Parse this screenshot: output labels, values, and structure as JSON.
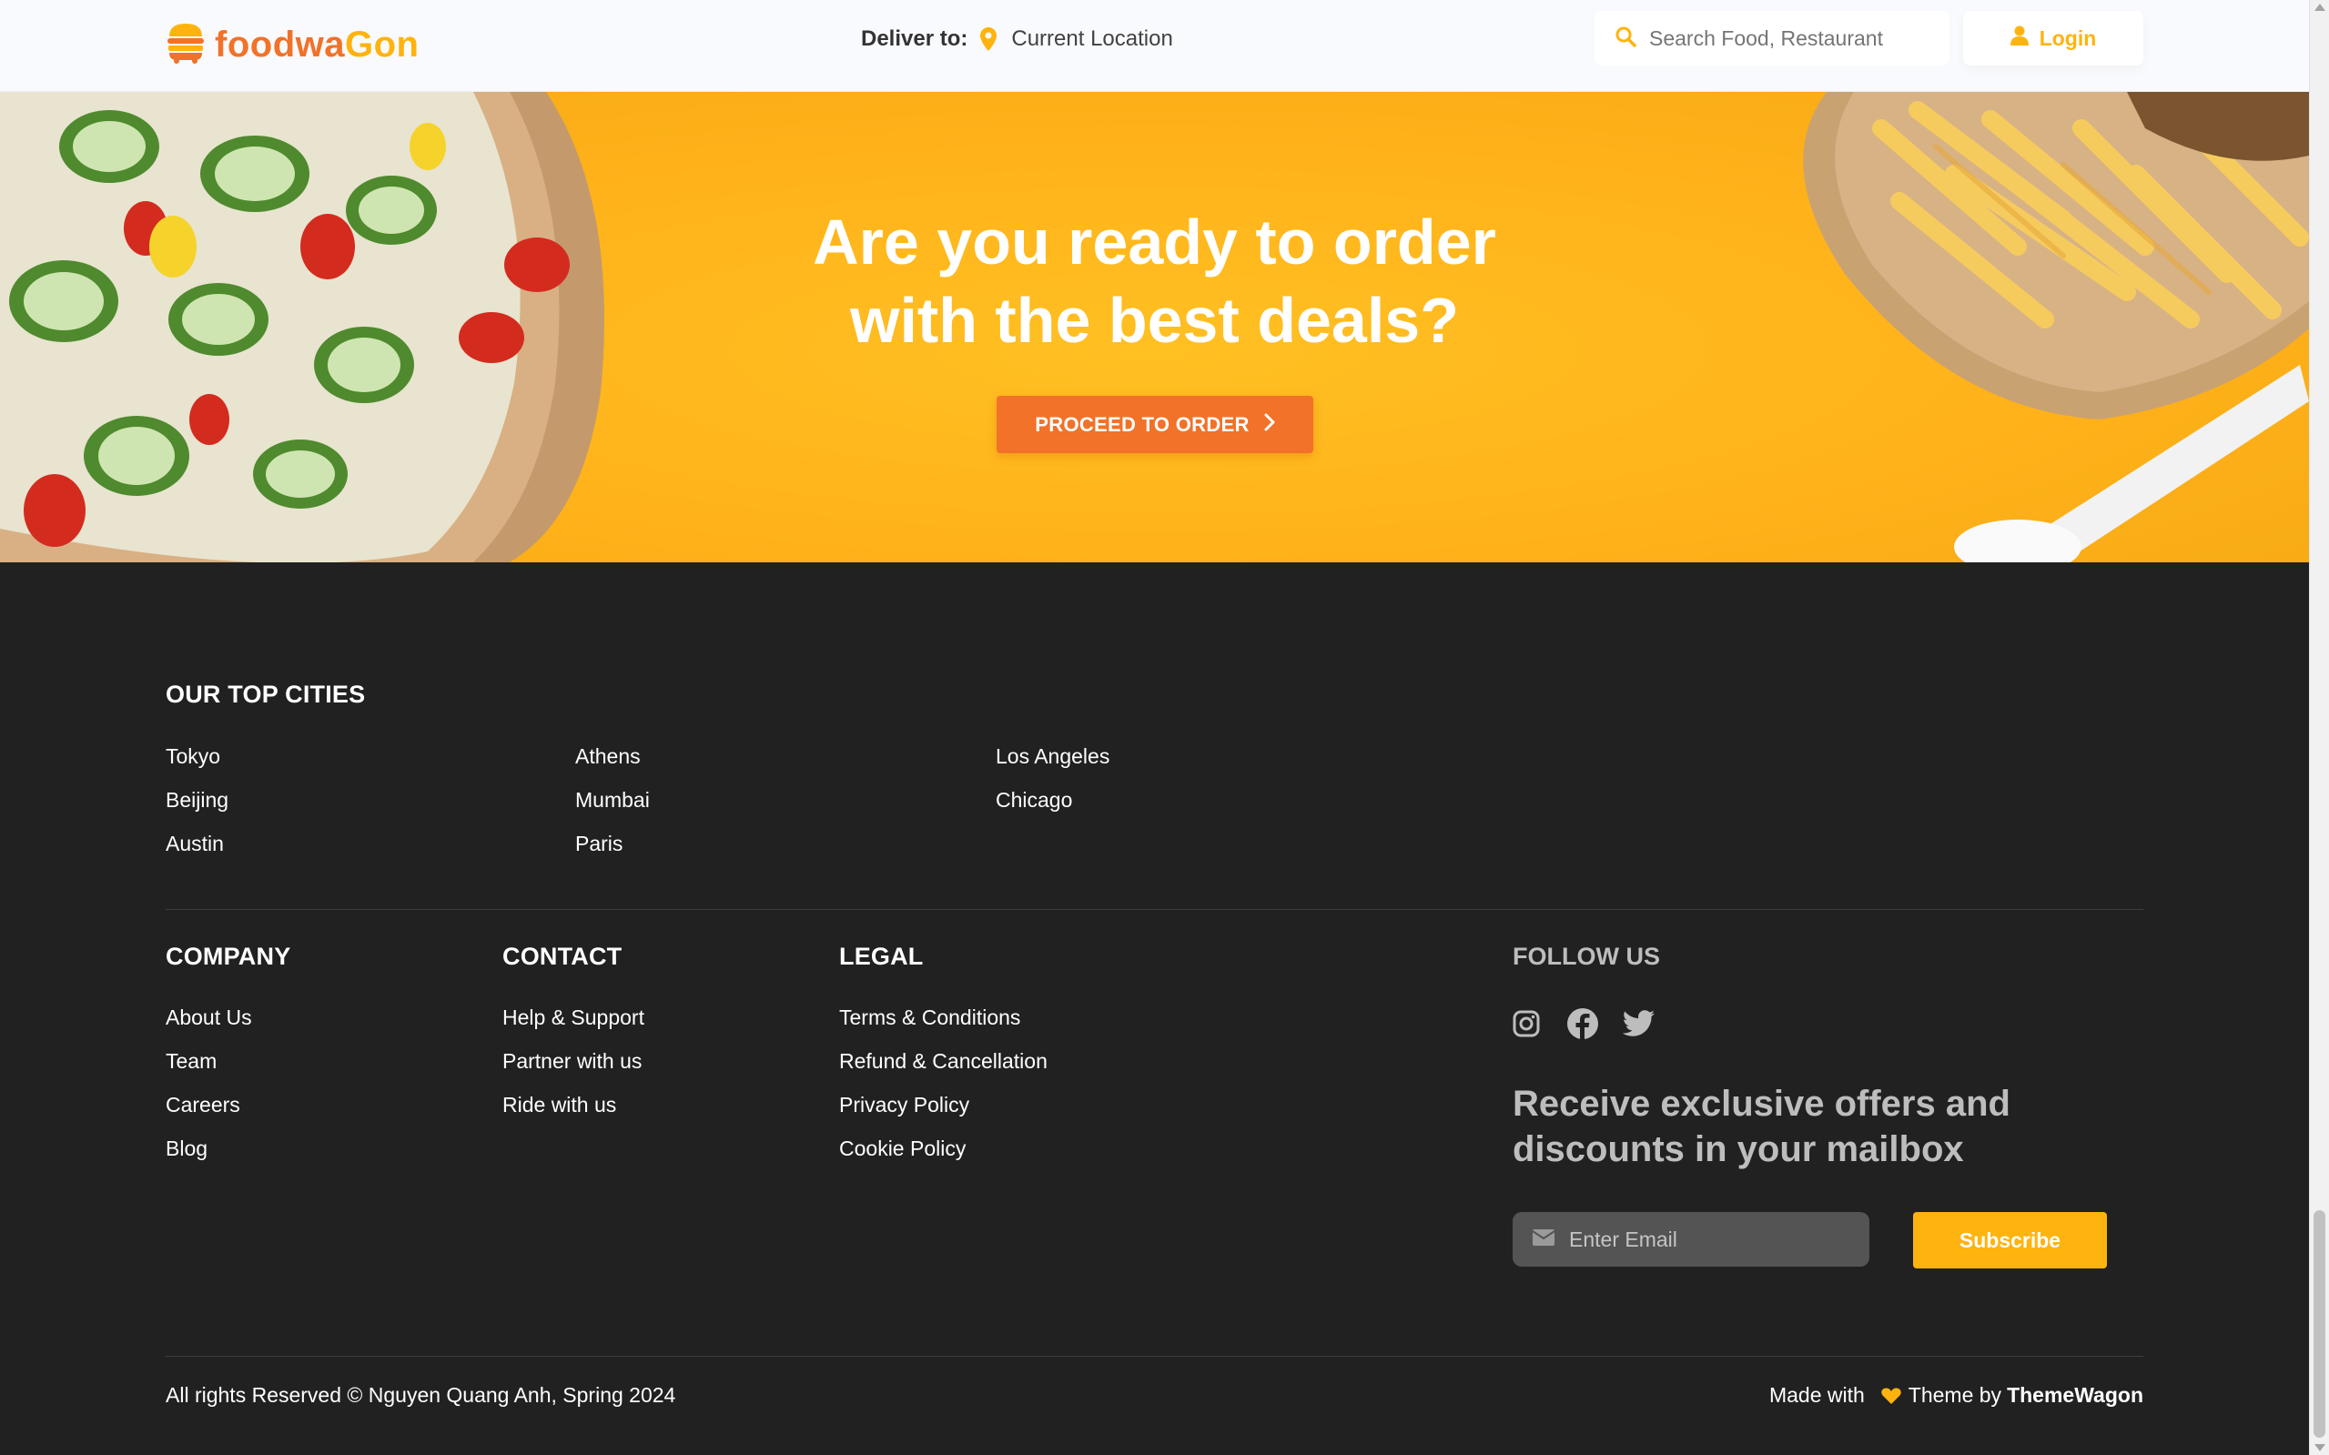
{
  "header": {
    "logo_text_a": "foodwa",
    "logo_text_b": "Gon",
    "deliver_label": "Deliver to:",
    "deliver_location": "Current Location",
    "search_placeholder": "Search Food, Restaurant",
    "login_label": "Login"
  },
  "hero": {
    "title_line1": "Are you ready to order",
    "title_line2": "with the best deals?",
    "cta_label": "PROCEED TO ORDER"
  },
  "footer": {
    "top_cities_title": "OUR TOP CITIES",
    "cities": [
      "Tokyo",
      "Beijing",
      "Austin",
      "Athens",
      "Mumbai",
      "Paris",
      "Los Angeles",
      "Chicago"
    ],
    "company": {
      "title": "COMPANY",
      "links": [
        "About Us",
        "Team",
        "Careers",
        "Blog"
      ]
    },
    "contact": {
      "title": "CONTACT",
      "links": [
        "Help & Support",
        "Partner with us",
        "Ride with us"
      ]
    },
    "legal": {
      "title": "LEGAL",
      "links": [
        "Terms & Conditions",
        "Refund & Cancellation",
        "Privacy Policy",
        "Cookie Policy"
      ]
    },
    "follow_title": "FOLLOW US",
    "social_icons": [
      "instagram-icon",
      "facebook-icon",
      "twitter-icon"
    ],
    "offers_text": "Receive exclusive offers and discounts in your mailbox",
    "email_placeholder": "Enter Email",
    "subscribe_label": "Subscribe",
    "copyright": "All rights Reserved © Nguyen Quang Anh, Spring 2024",
    "made_with": "Made with",
    "theme_by": "Theme by",
    "theme_name": "ThemeWagon"
  },
  "colors": {
    "primary_orange": "#f17228",
    "accent_yellow": "#ffb30e",
    "footer_bg": "#212121"
  }
}
